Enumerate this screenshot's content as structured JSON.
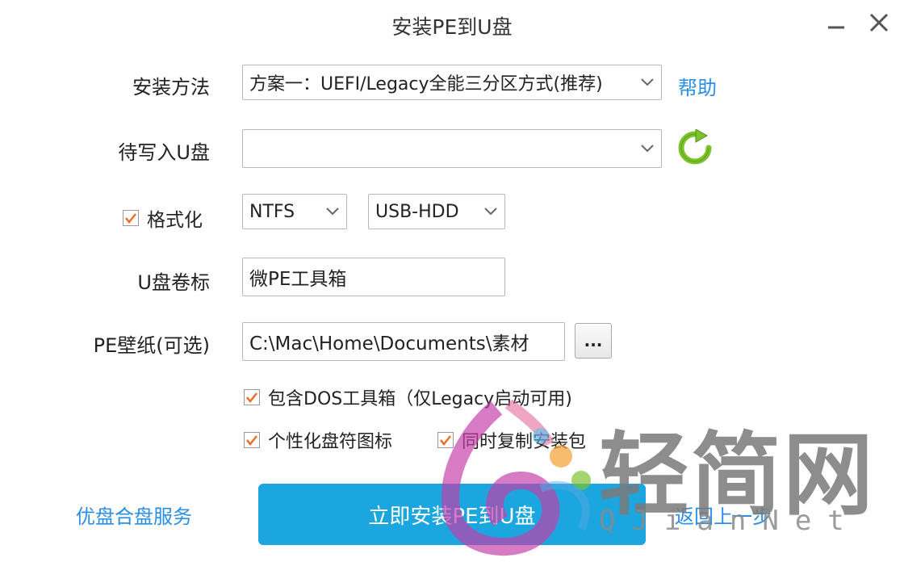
{
  "window": {
    "title": "安装PE到U盘",
    "minimize_icon": "minimize-icon",
    "close_icon": "close-icon"
  },
  "install_method": {
    "label": "安装方法",
    "value": "方案一：UEFI/Legacy全能三分区方式(推荐)",
    "help_link": "帮助"
  },
  "target_drive": {
    "label": "待写入U盘",
    "value": "",
    "refresh_icon": "refresh-icon"
  },
  "format": {
    "label": "格式化",
    "checked": true,
    "filesystem": "NTFS",
    "mode": "USB-HDD"
  },
  "volume_label": {
    "label": "U盘卷标",
    "value": "微PE工具箱"
  },
  "wallpaper": {
    "label": "PE壁纸(可选)",
    "value": "C:\\Mac\\Home\\Documents\\素材",
    "browse_label": "..."
  },
  "options": {
    "include_dos": "包含DOS工具箱（仅Legacy启动可用)",
    "custom_drive_icon": "个性化盘符图标",
    "copy_installer": "同时复制安装包"
  },
  "footer": {
    "left_link": "优盘合盘服务",
    "install_button": "立即安装PE到U盘",
    "back_link": "返回上一步"
  },
  "watermark": {
    "text": "轻简网",
    "subtext": "QJianNet"
  },
  "colors": {
    "accent": "#1ba6df",
    "link": "#2a8fe6",
    "checkmark": "#f26a2a",
    "refresh": "#7cc22a"
  }
}
